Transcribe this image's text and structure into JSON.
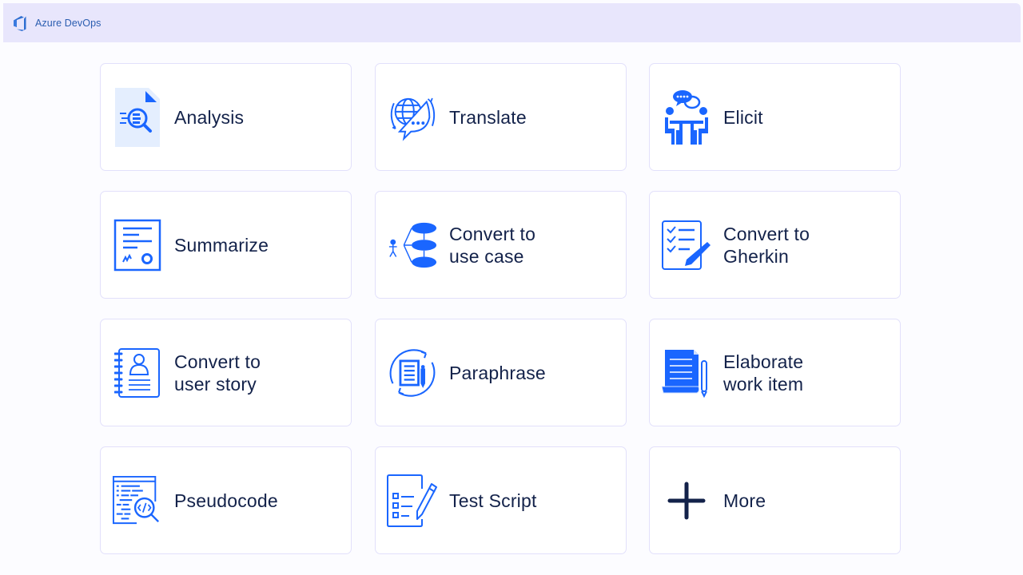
{
  "header": {
    "app_name": "Azure DevOps",
    "logo_icon": "azure-devops-logo-icon",
    "background_color": "#e8e6fc"
  },
  "colors": {
    "accent": "#1a66ff",
    "text": "#13224a",
    "card_border": "#e2e0fb"
  },
  "cards": [
    {
      "id": "analysis",
      "icon": "document-magnifier-icon",
      "lines": [
        "Analysis"
      ]
    },
    {
      "id": "translate",
      "icon": "globe-chat-translate-icon",
      "lines": [
        "Translate"
      ]
    },
    {
      "id": "elicit",
      "icon": "people-meeting-chat-icon",
      "lines": [
        "Elicit"
      ]
    },
    {
      "id": "summarize",
      "icon": "certificate-document-icon",
      "lines": [
        "Summarize"
      ]
    },
    {
      "id": "convert-use-case",
      "icon": "use-case-diagram-icon",
      "lines": [
        "Convert to",
        "use case"
      ]
    },
    {
      "id": "convert-gherkin",
      "icon": "checklist-pencil-icon",
      "lines": [
        "Convert to",
        "Gherkin"
      ]
    },
    {
      "id": "convert-user-story",
      "icon": "user-notebook-icon",
      "lines": [
        "Convert to",
        "user story"
      ]
    },
    {
      "id": "paraphrase",
      "icon": "document-cycle-icon",
      "lines": [
        "Paraphrase"
      ]
    },
    {
      "id": "elaborate-work-item",
      "icon": "document-pen-icon",
      "lines": [
        "Elaborate",
        "work item"
      ]
    },
    {
      "id": "pseudocode",
      "icon": "code-magnifier-icon",
      "lines": [
        "Pseudocode"
      ]
    },
    {
      "id": "test-script",
      "icon": "checkbox-list-pencil-icon",
      "lines": [
        "Test Script"
      ]
    },
    {
      "id": "more",
      "icon": "plus-icon",
      "lines": [
        "More"
      ]
    }
  ]
}
